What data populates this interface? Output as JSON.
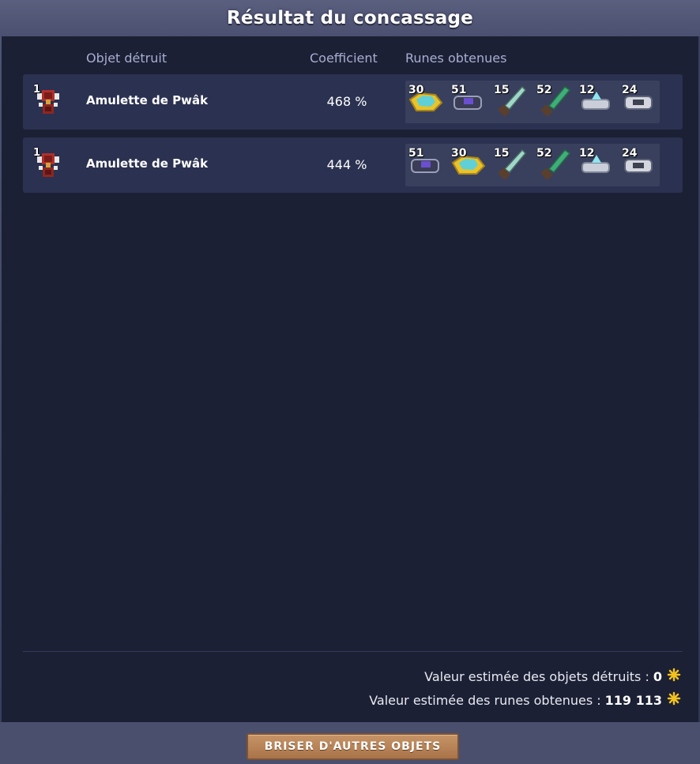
{
  "window": {
    "title": "Résultat du concassage"
  },
  "headers": {
    "object": "Objet détruit",
    "coefficient": "Coefficient",
    "runes": "Runes obtenues"
  },
  "rows": [
    {
      "quantity": "1",
      "name": "Amulette de Pwâk",
      "coefficient": "468 %",
      "icon": "amulet-icon",
      "runes": [
        {
          "qty": "30",
          "icon": "gold-rune-icon"
        },
        {
          "qty": "51",
          "icon": "dark-rune-icon"
        },
        {
          "qty": "15",
          "icon": "blade-rune-icon"
        },
        {
          "qty": "52",
          "icon": "green-blade-rune-icon"
        },
        {
          "qty": "12",
          "icon": "crystal-rune-icon"
        },
        {
          "qty": "24",
          "icon": "silver-rune-icon"
        }
      ]
    },
    {
      "quantity": "1",
      "name": "Amulette de Pwâk",
      "coefficient": "444 %",
      "icon": "amulet-icon",
      "runes": [
        {
          "qty": "51",
          "icon": "dark-rune-icon"
        },
        {
          "qty": "30",
          "icon": "gold-rune-icon"
        },
        {
          "qty": "15",
          "icon": "blade-rune-icon"
        },
        {
          "qty": "52",
          "icon": "green-blade-rune-icon"
        },
        {
          "qty": "12",
          "icon": "crystal-rune-icon"
        },
        {
          "qty": "24",
          "icon": "silver-rune-icon"
        }
      ]
    }
  ],
  "summary": {
    "objects_label": "Valeur estimée des objets détruits :",
    "objects_value": "0",
    "runes_label": "Valeur estimée des runes obtenues :",
    "runes_value": "119 113",
    "currency_icon": "kama-icon"
  },
  "footer": {
    "button_label": "BRISER D'AUTRES OBJETS"
  },
  "colors": {
    "panel": "#1c2034",
    "row": "#2b3150",
    "header_text": "#a8aed2",
    "button": "#b8845a",
    "kama": "#f2c21d"
  }
}
